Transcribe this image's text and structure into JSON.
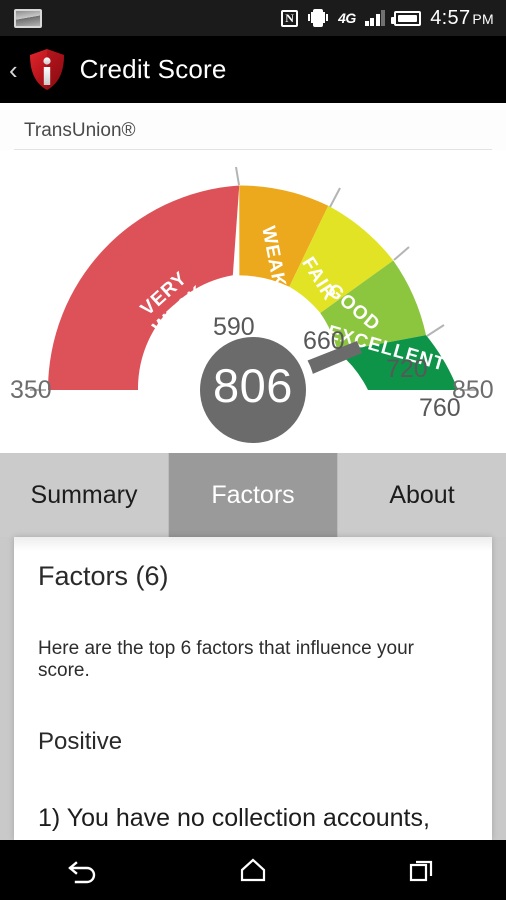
{
  "statusbar": {
    "screenshot_icon": "screenshot-icon",
    "nfc_icon": "N",
    "vibrate_icon": "vibrate-icon",
    "network": "4G",
    "signal_icon": "signal-bars-icon",
    "battery_icon": "battery-icon",
    "time": "4:57",
    "ampm": "PM"
  },
  "appbar": {
    "back_icon": "‹",
    "logo": "credit-shield-logo",
    "title": "Credit Score"
  },
  "bureau": {
    "name": "TransUnion®"
  },
  "chart_data": {
    "type": "gauge",
    "title": "Credit Score",
    "score": 806,
    "min": 350,
    "max": 850,
    "min_label": "350",
    "max_label": "850",
    "score_label": "806",
    "needle_value": 806,
    "ticks": [
      {
        "value": 590,
        "label": "590"
      },
      {
        "value": 660,
        "label": "660"
      },
      {
        "value": 720,
        "label": "720"
      },
      {
        "value": 760,
        "label": "760"
      }
    ],
    "segments": [
      {
        "name": "VERY WEAK",
        "from": 350,
        "to": 590,
        "color": "#dd5259"
      },
      {
        "name": "WEAK",
        "from": 590,
        "to": 660,
        "color": "#eda91d"
      },
      {
        "name": "FAIR",
        "from": 660,
        "to": 720,
        "color": "#e3e326"
      },
      {
        "name": "GOOD",
        "from": 720,
        "to": 760,
        "color": "#8cc63f"
      },
      {
        "name": "EXCELLENT",
        "from": 760,
        "to": 850,
        "color": "#0e9448"
      }
    ],
    "hub_color": "#6b6b6b",
    "needle_color": "#6b6b6b"
  },
  "tabs": [
    {
      "label": "Summary",
      "active": false
    },
    {
      "label": "Factors",
      "active": true
    },
    {
      "label": "About",
      "active": false
    }
  ],
  "content": {
    "heading": "Factors (6)",
    "description": "Here are the top 6 factors that influence your score.",
    "section": "Positive",
    "item_1": "1) You have no collection accounts,"
  },
  "navbar": {
    "back": "back-icon",
    "home": "home-icon",
    "recents": "recents-icon"
  }
}
